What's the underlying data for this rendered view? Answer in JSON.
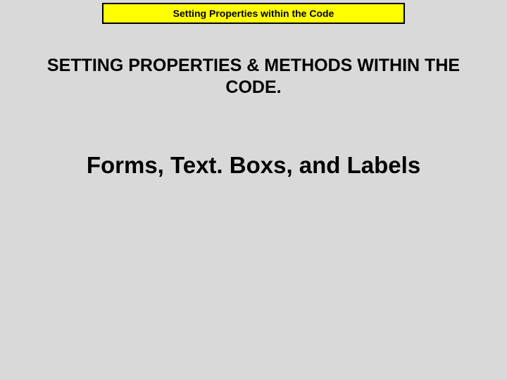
{
  "banner": {
    "title": "Setting Properties within the Code"
  },
  "heading": {
    "text": "SETTING PROPERTIES & METHODS WITHIN THE CODE."
  },
  "subheading": {
    "text": "Forms, Text. Boxs, and Labels"
  }
}
